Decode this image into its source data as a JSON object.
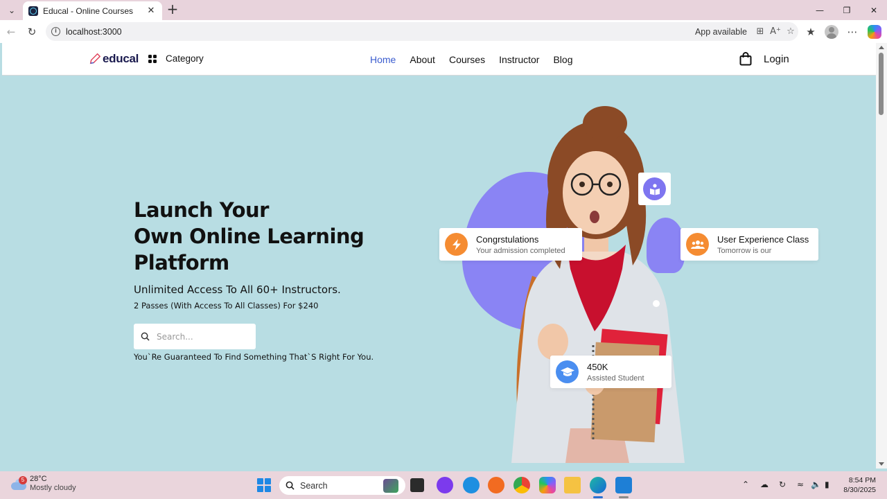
{
  "browser": {
    "tab_title": "Educal - Online Courses",
    "url": "localhost:3000",
    "app_available": "App available"
  },
  "site": {
    "logo_text": "educal",
    "category_label": "Category",
    "nav": [
      {
        "label": "Home",
        "active": true
      },
      {
        "label": "About",
        "active": false
      },
      {
        "label": "Courses",
        "active": false
      },
      {
        "label": "Instructor",
        "active": false
      },
      {
        "label": "Blog",
        "active": false
      }
    ],
    "login_label": "Login",
    "accent_color": "#3b5ccf"
  },
  "hero": {
    "title_lines": [
      "Launch Your",
      "Own Online Learning",
      "Platform"
    ],
    "subtitle": "Unlimited Access To All 60+ Instructors.",
    "passes": "2 Passes (With Access To All Classes) For $240",
    "search_placeholder": "Search...",
    "note": "You`Re Guaranteed To Find Something That`S Right For You.",
    "bg_color": "#b8dde3",
    "blob_color": "#8a84f4"
  },
  "cards": {
    "congrats": {
      "title": "Congrstulations",
      "subtitle": "Your admission completed",
      "icon": "lightning-icon",
      "color": "#f58c32"
    },
    "ux_class": {
      "title": "User Experience Class",
      "subtitle": "Tomorrow is our",
      "icon": "users-icon",
      "color": "#f58c32"
    },
    "students": {
      "title": "450K",
      "subtitle": "Assisted Student",
      "icon": "graduation-cap-icon",
      "color": "#4a8ef0"
    },
    "book": {
      "icon": "book-reader-icon",
      "color": "#7e75f0"
    }
  },
  "taskbar": {
    "weather_temp": "28°C",
    "weather_condition": "Mostly cloudy",
    "weather_badge": "5",
    "search_label": "Search",
    "time": "8:54 PM",
    "date": "8/30/2025"
  }
}
